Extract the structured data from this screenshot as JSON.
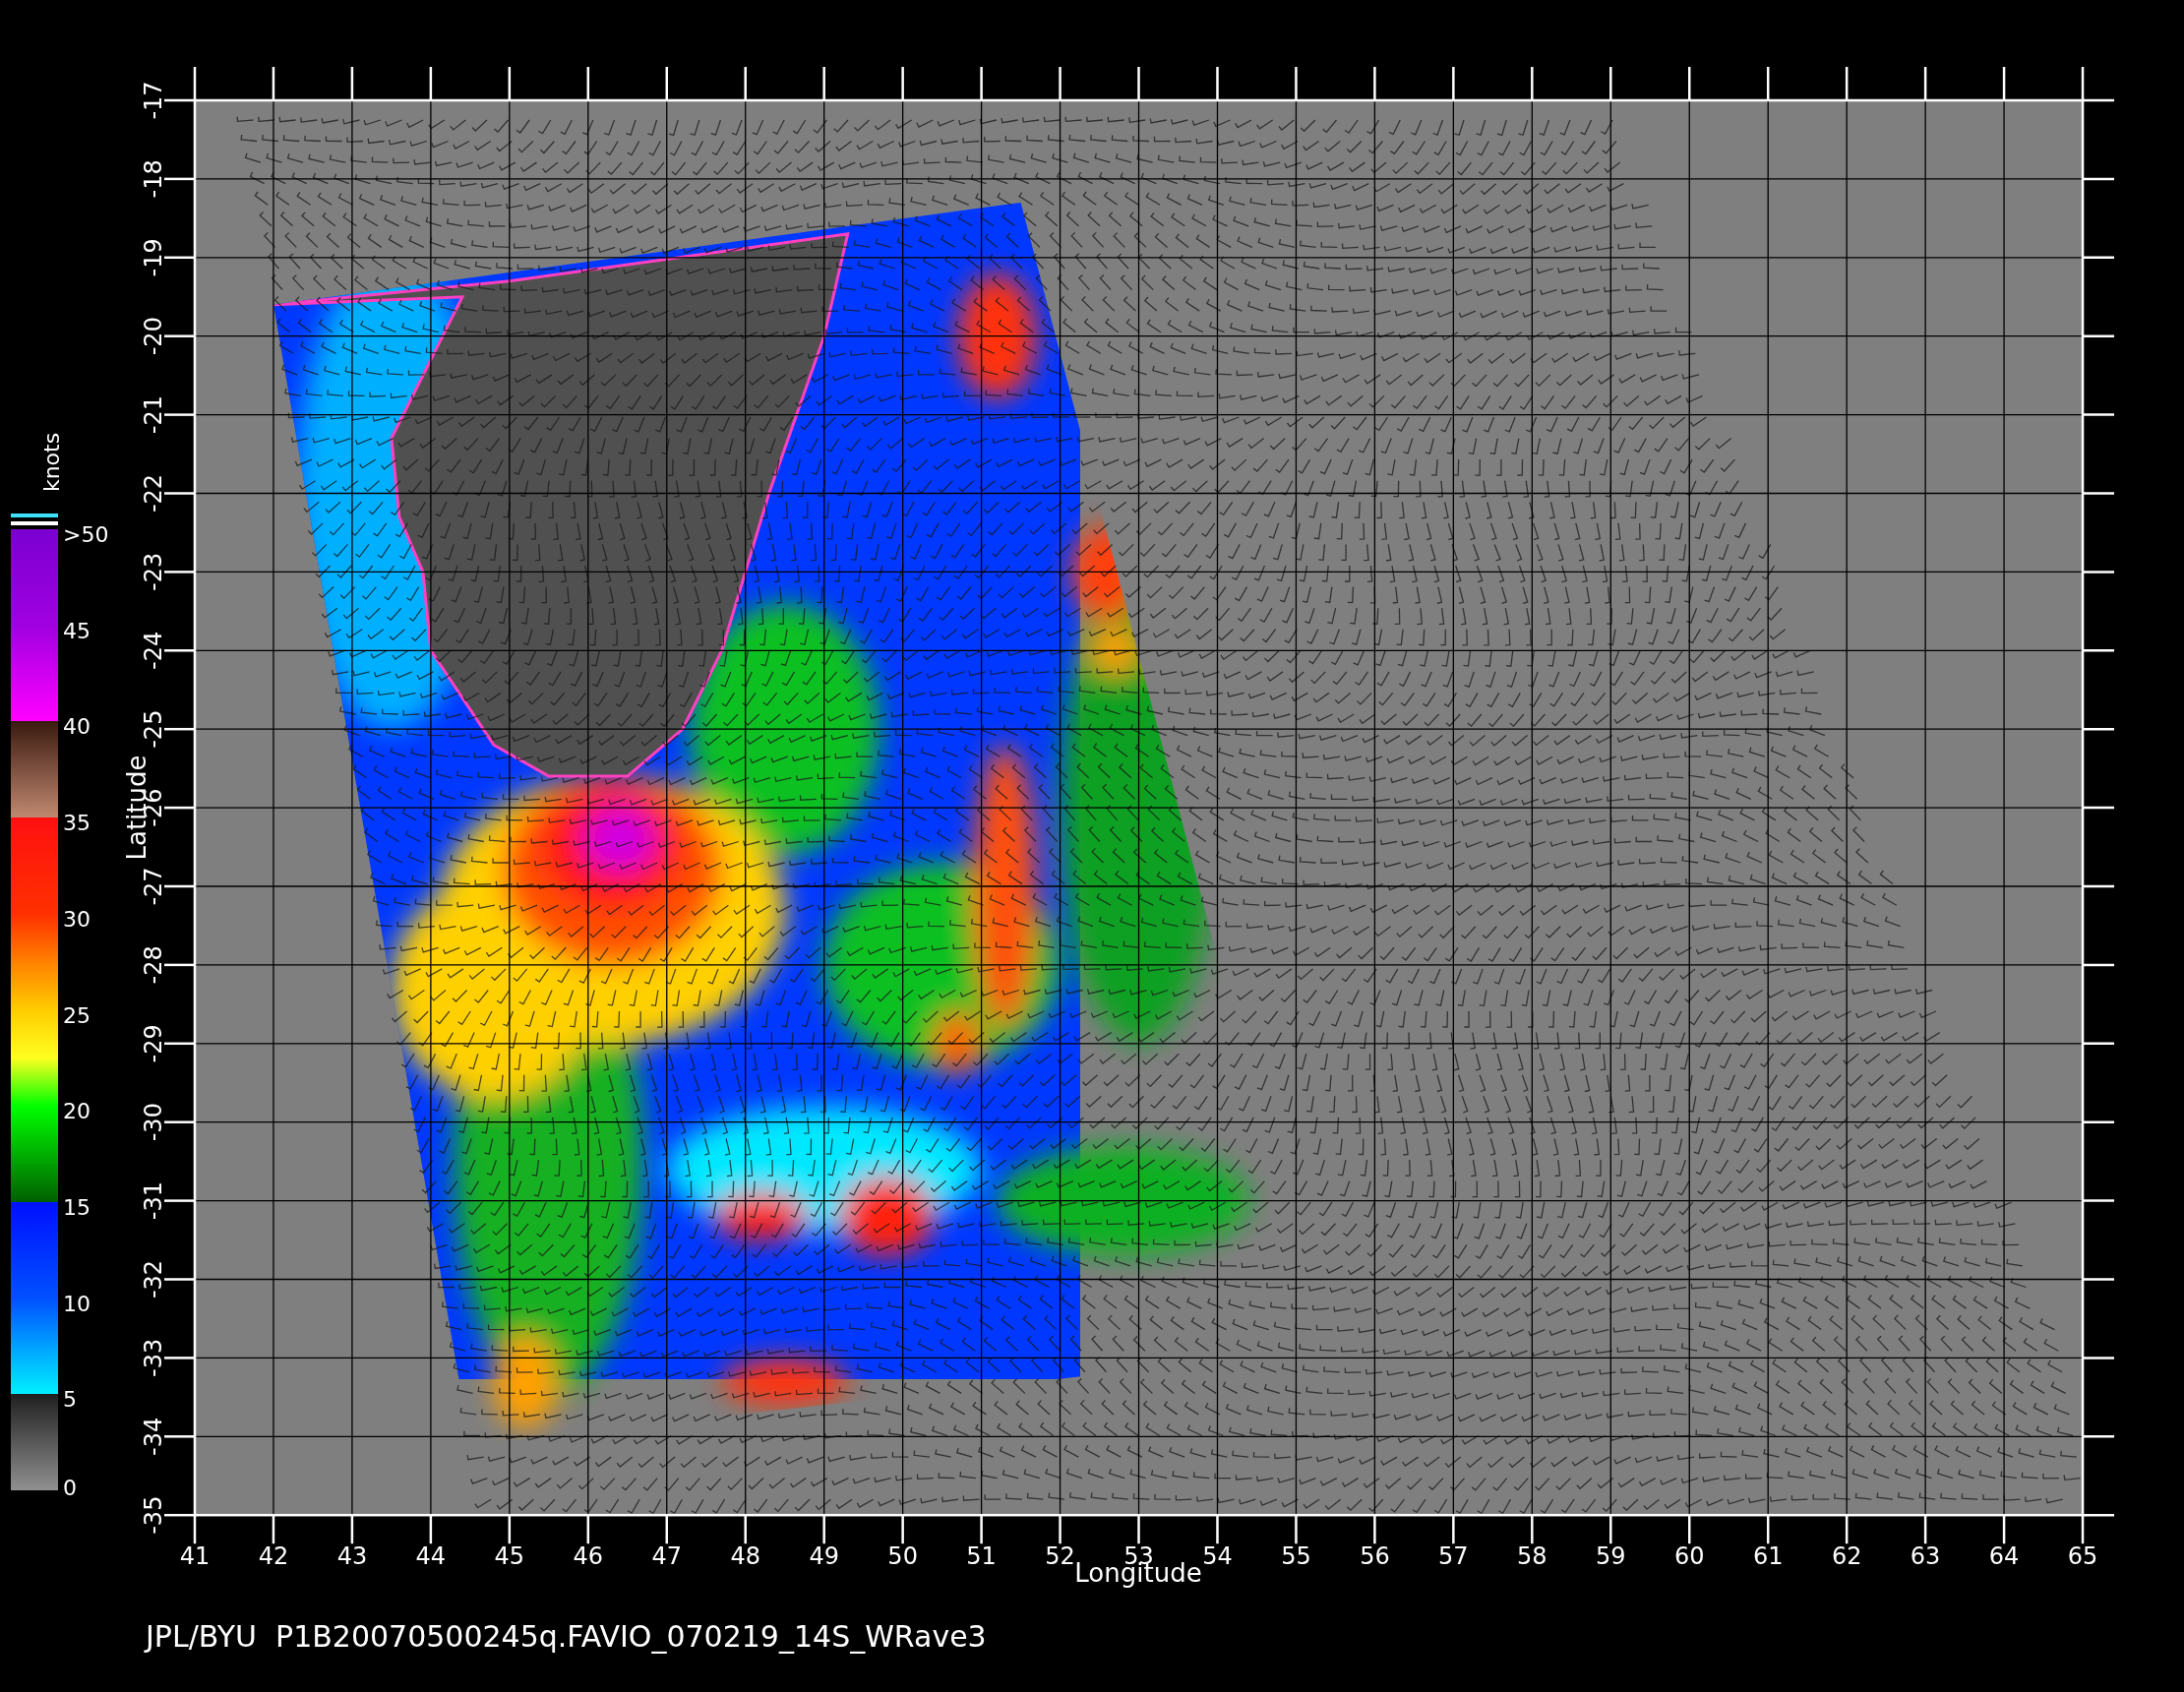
{
  "plot": {
    "latitude_ticks": [
      "-17",
      "-18",
      "-19",
      "-20",
      "-21",
      "-22",
      "-23",
      "-24",
      "-25",
      "-26",
      "-27",
      "-28",
      "-29",
      "-30",
      "-31",
      "-32",
      "-33",
      "-34",
      "-35"
    ],
    "longitude_ticks": [
      "41",
      "42",
      "43",
      "44",
      "45",
      "46",
      "47",
      "48",
      "49",
      "50",
      "51",
      "52",
      "53",
      "54",
      "55",
      "56",
      "57",
      "58",
      "59",
      "60",
      "61",
      "62",
      "63",
      "64",
      "65"
    ],
    "xlabel": "Longitude",
    "ylabel": "Latitude"
  },
  "color_scale": {
    "unit": "knots",
    "labels": [
      ">50",
      "45",
      "40",
      "35",
      "30",
      "25",
      "20",
      "15",
      "10",
      "5",
      "0"
    ]
  },
  "footer": {
    "caption": "JPL/BYU  P1B20070500245q.FAVIO_070219_14S_WRave3"
  }
}
